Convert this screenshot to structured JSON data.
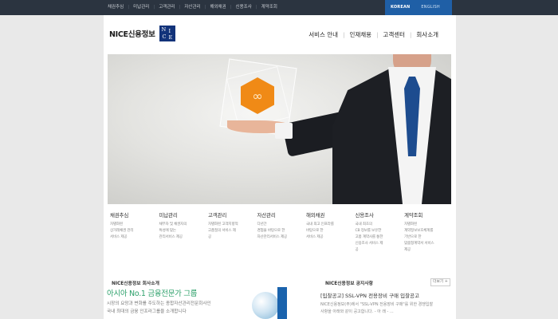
{
  "topbar": {
    "nav": [
      "채권추심",
      "미납관리",
      "고객관리",
      "자산관리",
      "해외채권",
      "신용조사",
      "계약조회"
    ],
    "languages": [
      "KOREAN",
      "ENGLISH"
    ]
  },
  "header": {
    "logo_text": "NICE신용정보",
    "logo_letters": [
      "N",
      "I",
      "C",
      "E"
    ],
    "nav": [
      "서비스 안내",
      "인재채용",
      "고객센터",
      "회사소개"
    ]
  },
  "services": [
    {
      "title": "채권추심",
      "lines": [
        "차별화된",
        "상거래채권 관리",
        "서비스 제공"
      ]
    },
    {
      "title": "미납관리",
      "lines": [
        "채무자 및 채권자의",
        "특성에 맞는",
        "관리서비스 제공"
      ]
    },
    {
      "title": "고객관리",
      "lines": [
        "차별화된 고객지향적",
        "고품질의 서비스 제",
        "공"
      ]
    },
    {
      "title": "자산관리",
      "lines": [
        "다년간",
        "경험을 바탕으로 한",
        "자산관리서비스 제공"
      ]
    },
    {
      "title": "해외채권",
      "lines": [
        "국내 최고 인프라를",
        "바탕으로 한",
        "서비스 제공"
      ]
    },
    {
      "title": "신용조사",
      "lines": [
        "국내 최초의",
        "CB 정보를 보유한",
        "고품 계약사를 통한",
        "신용조사 서비스 제",
        "공"
      ]
    },
    {
      "title": "계약조회",
      "lines": [
        "차별화된",
        "계약정보보호체계를",
        "기반으로 한",
        "맞춤형계약서 서비스",
        "제공"
      ]
    }
  ],
  "about": {
    "section_title": "NICE신용정보 회사소개",
    "headline": "아시아 No.1 금융전문가 그룹",
    "lines": [
      "시장의 요망과 변화를 주도하는 종합자산관리전문회사인",
      "국내 최대의 금융 인프라그룹을 소개합니다"
    ]
  },
  "notice": {
    "section_title": "NICE신용정보 공지사항",
    "more_label": "더보기 +",
    "title": "[입찰공고] SSL-VPN 전용장비 구매 입찰공고",
    "lines": [
      "NICE신용정보(주)에서 \"SSL-VPN 전용장비 구매\"를 위한 경쟁입찰",
      "사항을 아래와 같이 공고합니다. - 아 래 - ..."
    ]
  },
  "colors": {
    "topbar": "#2b3440",
    "lang_active": "#1f5fa6",
    "logo_box": "#12337a",
    "accent_green": "#2ca06a",
    "hex_orange": "#f08a16",
    "tie_blue": "#1d4c8f"
  }
}
